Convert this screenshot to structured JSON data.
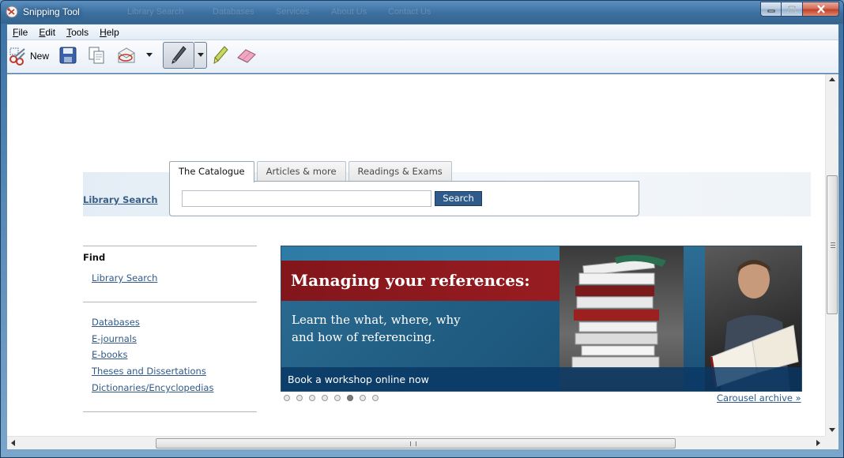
{
  "window": {
    "title": "Snipping Tool",
    "ghost_nav": [
      "Library Search",
      "Databases",
      "Services",
      "About Us",
      "Contact Us"
    ]
  },
  "menu": {
    "items": [
      {
        "label": "File"
      },
      {
        "label": "Edit"
      },
      {
        "label": "Tools"
      },
      {
        "label": "Help"
      }
    ]
  },
  "toolbar": {
    "new_label": "New"
  },
  "page": {
    "library_search_link": "Library Search",
    "tabs": [
      {
        "label": "The Catalogue",
        "active": true
      },
      {
        "label": "Articles & more",
        "active": false
      },
      {
        "label": "Readings & Exams",
        "active": false
      }
    ],
    "search": {
      "value": "",
      "button_label": "Search"
    },
    "nav": {
      "heading": "Find",
      "find_links": [
        "Library Search"
      ],
      "resource_links": [
        "Databases",
        "E-journals",
        "E-books",
        "Theses and Dissertations",
        "Dictionaries/Encyclopedias"
      ]
    },
    "carousel": {
      "title": "Managing your references:",
      "subtitle_line1": "Learn the what, where, why",
      "subtitle_line2": "and how of referencing.",
      "cta": "Book a workshop online now",
      "dot_count": 8,
      "active_dot": 6,
      "archive_link": "Carousel archive »"
    }
  },
  "colors": {
    "link": "#2f5a87",
    "banner_red": "#9a1d22",
    "search_button": "#2f5b8a"
  }
}
